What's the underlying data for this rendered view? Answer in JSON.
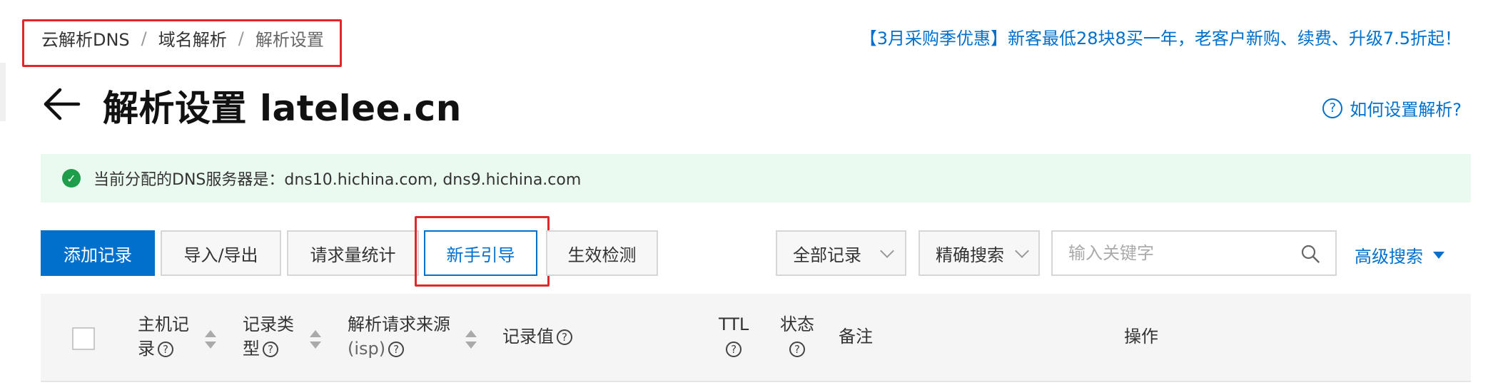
{
  "breadcrumb": {
    "items": [
      "云解析DNS",
      "域名解析",
      "解析设置"
    ],
    "separator": "/"
  },
  "promo_text": "【3月采购季优惠】新客最低28块8买一年，老客户新购、续费、升级7.5折起！",
  "page": {
    "title": "解析设置 latelee.cn"
  },
  "help": {
    "icon": "?",
    "label": "如何设置解析?"
  },
  "notice": {
    "icon": "✓",
    "text": "当前分配的DNS服务器是：dns10.hichina.com, dns9.hichina.com"
  },
  "toolbar": {
    "add_label": "添加记录",
    "import_label": "导入/导出",
    "stats_label": "请求量统计",
    "guide_label": "新手引导",
    "check_label": "生效检测",
    "filter_label": "全部记录",
    "search_mode_label": "精确搜索",
    "search_placeholder": "输入关键字",
    "advanced_label": "高级搜索"
  },
  "table": {
    "headers": {
      "host_line1": "主机记",
      "host_line2": "录",
      "type_line1": "记录类",
      "type_line2": "型",
      "source_line1": "解析请求来源",
      "source_line2": "(isp)",
      "value": "记录值",
      "ttl": "TTL",
      "status": "状态",
      "remark": "备注",
      "actions": "操作"
    },
    "help_mark": "?"
  },
  "colors": {
    "brand_blue": "#0070cc",
    "highlight_red": "#e0282a",
    "success_green": "#1e9e4a",
    "notice_bg": "#ebfaf0"
  }
}
